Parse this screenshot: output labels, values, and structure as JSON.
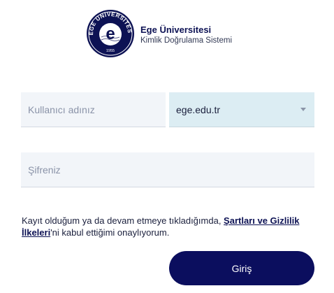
{
  "brand": {
    "title": "Ege Üniversitesi",
    "subtitle": "Kimlik Doğrulama Sistemi",
    "logo_top_text": "EGE ÜNİVERSİTESİ",
    "logo_year": "1955",
    "logo_letter": "e",
    "color": "#0d1254"
  },
  "form": {
    "username_placeholder": "Kullanıcı adınız",
    "domain_value": "ege.edu.tr",
    "password_placeholder": "Şifreniz",
    "terms_prefix": "Kayıt olduğum ya da devam etmeye tıkladığımda, ",
    "terms_link": "Şartları ve Gizlilik İlkeleri",
    "terms_suffix": "'ni kabul ettiğimi onaylıyorum.",
    "submit_label": "Giriş",
    "submit_color": "#0b0e5e",
    "domain_bg_color": "#dcedf3"
  }
}
